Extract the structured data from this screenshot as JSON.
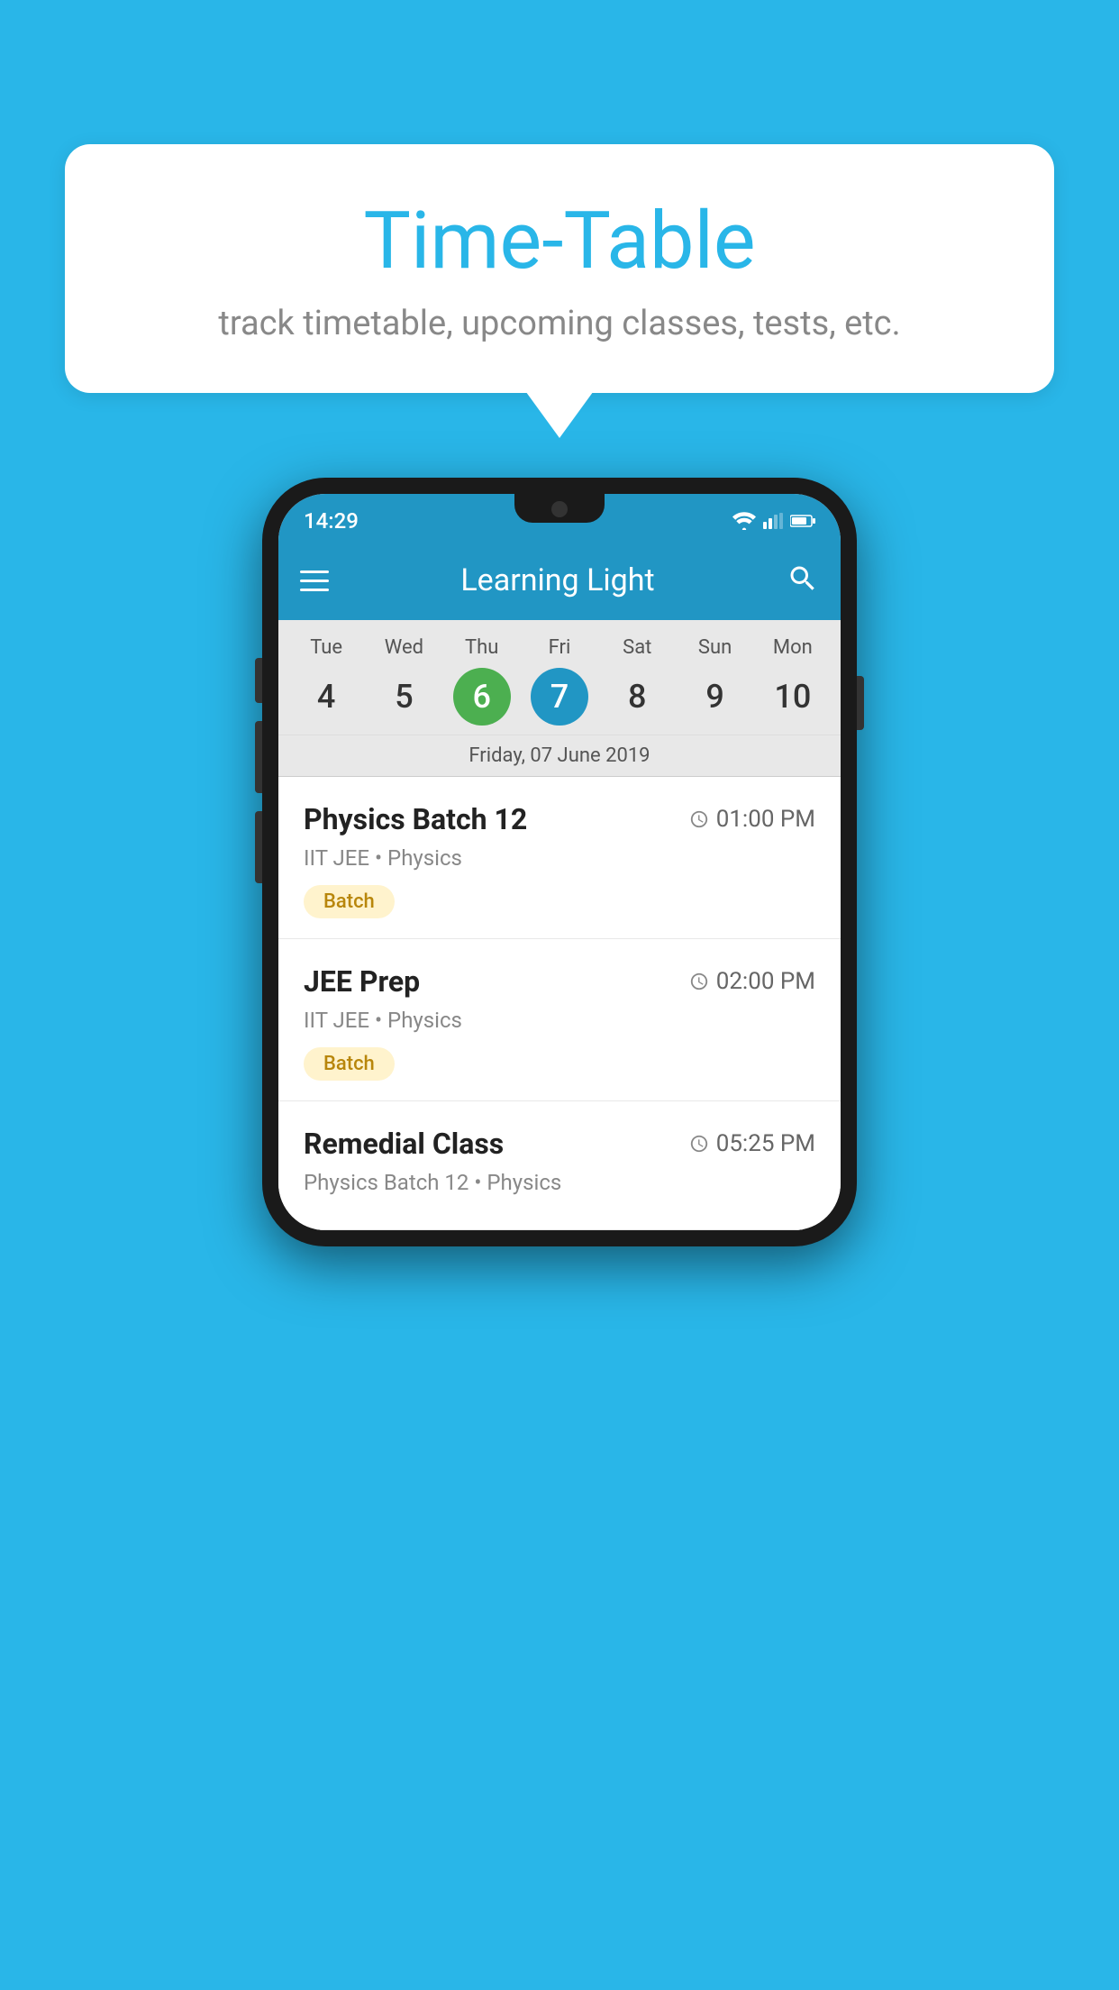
{
  "background_color": "#29b6e8",
  "speech_bubble": {
    "title": "Time-Table",
    "subtitle": "track timetable, upcoming classes, tests, etc."
  },
  "phone": {
    "status_bar": {
      "time": "14:29"
    },
    "app_bar": {
      "title": "Learning Light"
    },
    "calendar": {
      "days": [
        {
          "name": "Tue",
          "num": "4",
          "state": "normal"
        },
        {
          "name": "Wed",
          "num": "5",
          "state": "normal"
        },
        {
          "name": "Thu",
          "num": "6",
          "state": "today"
        },
        {
          "name": "Fri",
          "num": "7",
          "state": "selected"
        },
        {
          "name": "Sat",
          "num": "8",
          "state": "normal"
        },
        {
          "name": "Sun",
          "num": "9",
          "state": "normal"
        },
        {
          "name": "Mon",
          "num": "10",
          "state": "normal"
        }
      ],
      "date_label": "Friday, 07 June 2019"
    },
    "classes": [
      {
        "name": "Physics Batch 12",
        "time": "01:00 PM",
        "detail": "IIT JEE • Physics",
        "badge": "Batch"
      },
      {
        "name": "JEE Prep",
        "time": "02:00 PM",
        "detail": "IIT JEE • Physics",
        "badge": "Batch"
      },
      {
        "name": "Remedial Class",
        "time": "05:25 PM",
        "detail": "Physics Batch 12 • Physics",
        "badge": ""
      }
    ]
  },
  "icons": {
    "hamburger": "hamburger-icon",
    "search": "🔍",
    "clock": "⏱"
  }
}
